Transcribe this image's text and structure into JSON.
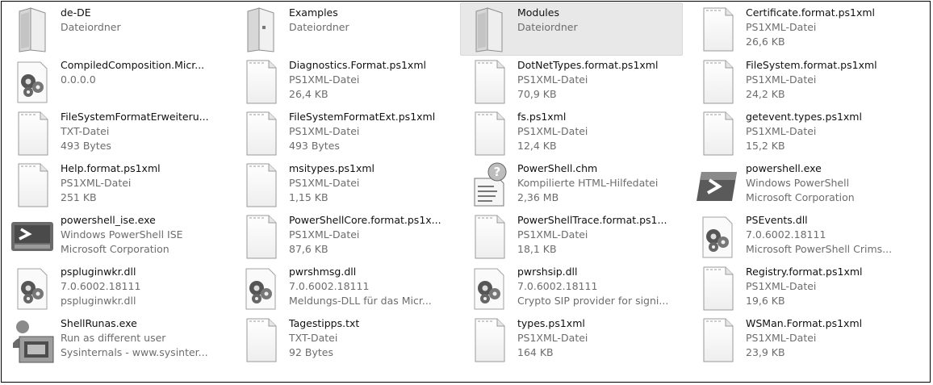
{
  "files": [
    {
      "name": "de-DE",
      "type": "Dateiordner",
      "info": "",
      "icon": "folder-icon",
      "selected": false
    },
    {
      "name": "Examples",
      "type": "Dateiordner",
      "info": "",
      "icon": "folder-doc-icon",
      "selected": false
    },
    {
      "name": "Modules",
      "type": "Dateiordner",
      "info": "",
      "icon": "folder-icon",
      "selected": true
    },
    {
      "name": "Certificate.format.ps1xml",
      "type": "PS1XML-Datei",
      "info": "26,6 KB",
      "icon": "document-icon",
      "selected": false
    },
    {
      "name": "CompiledComposition.Micr...",
      "type": "0.0.0.0",
      "info": "",
      "icon": "dll-gear-icon",
      "selected": false
    },
    {
      "name": "Diagnostics.Format.ps1xml",
      "type": "PS1XML-Datei",
      "info": "26,4 KB",
      "icon": "document-icon",
      "selected": false
    },
    {
      "name": "DotNetTypes.format.ps1xml",
      "type": "PS1XML-Datei",
      "info": "70,9 KB",
      "icon": "document-icon",
      "selected": false
    },
    {
      "name": "FileSystem.format.ps1xml",
      "type": "PS1XML-Datei",
      "info": "24,2 KB",
      "icon": "document-icon",
      "selected": false
    },
    {
      "name": "FileSystemFormatErweiteru...",
      "type": "TXT-Datei",
      "info": "493 Bytes",
      "icon": "document-icon",
      "selected": false
    },
    {
      "name": "FileSystemFormatExt.ps1xml",
      "type": "PS1XML-Datei",
      "info": "493 Bytes",
      "icon": "document-icon",
      "selected": false
    },
    {
      "name": "fs.ps1xml",
      "type": "PS1XML-Datei",
      "info": "12,4 KB",
      "icon": "document-icon",
      "selected": false
    },
    {
      "name": "getevent.types.ps1xml",
      "type": "PS1XML-Datei",
      "info": "15,2 KB",
      "icon": "document-icon",
      "selected": false
    },
    {
      "name": "Help.format.ps1xml",
      "type": "PS1XML-Datei",
      "info": "251 KB",
      "icon": "document-icon",
      "selected": false
    },
    {
      "name": "msitypes.ps1xml",
      "type": "PS1XML-Datei",
      "info": "1,15 KB",
      "icon": "document-icon",
      "selected": false
    },
    {
      "name": "PowerShell.chm",
      "type": "Kompilierte HTML-Hilfedatei",
      "info": "2,36 MB",
      "icon": "help-chm-icon",
      "selected": false
    },
    {
      "name": "powershell.exe",
      "type": "Windows PowerShell",
      "info": "Microsoft Corporation",
      "icon": "powershell-icon",
      "selected": false
    },
    {
      "name": "powershell_ise.exe",
      "type": "Windows PowerShell ISE",
      "info": "Microsoft Corporation",
      "icon": "powershell-ise-icon",
      "selected": false
    },
    {
      "name": "PowerShellCore.format.ps1x...",
      "type": "PS1XML-Datei",
      "info": "87,6 KB",
      "icon": "document-icon",
      "selected": false
    },
    {
      "name": "PowerShellTrace.format.ps1...",
      "type": "PS1XML-Datei",
      "info": "18,1 KB",
      "icon": "document-icon",
      "selected": false
    },
    {
      "name": "PSEvents.dll",
      "type": "7.0.6002.18111",
      "info": "Microsoft PowerShell Crims...",
      "icon": "dll-gear-icon",
      "selected": false
    },
    {
      "name": "pspluginwkr.dll",
      "type": "7.0.6002.18111",
      "info": "pspluginwkr.dll",
      "icon": "dll-gear-icon",
      "selected": false
    },
    {
      "name": "pwrshmsg.dll",
      "type": "7.0.6002.18111",
      "info": "Meldungs-DLL für das Micr...",
      "icon": "dll-gear-icon",
      "selected": false
    },
    {
      "name": "pwrshsip.dll",
      "type": "7.0.6002.18111",
      "info": "Crypto SIP provider for signi...",
      "icon": "dll-gear-icon",
      "selected": false
    },
    {
      "name": "Registry.format.ps1xml",
      "type": "PS1XML-Datei",
      "info": "19,6 KB",
      "icon": "document-icon",
      "selected": false
    },
    {
      "name": "ShellRunas.exe",
      "type": "Run as different user",
      "info": "Sysinternals - www.sysinter...",
      "icon": "runas-icon",
      "selected": false
    },
    {
      "name": "Tagestipps.txt",
      "type": "TXT-Datei",
      "info": "92 Bytes",
      "icon": "document-icon",
      "selected": false
    },
    {
      "name": "types.ps1xml",
      "type": "PS1XML-Datei",
      "info": "164 KB",
      "icon": "document-icon",
      "selected": false
    },
    {
      "name": "WSMan.Format.ps1xml",
      "type": "PS1XML-Datei",
      "info": "23,9 KB",
      "icon": "document-icon",
      "selected": false
    }
  ]
}
